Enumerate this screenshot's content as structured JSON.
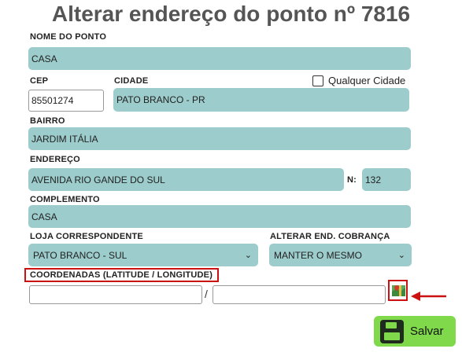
{
  "title": "Alterar endereço do ponto nº 7816",
  "fields": {
    "nome_label": "NOME DO PONTO",
    "nome_value": "CASA",
    "cep_label": "CEP",
    "cep_value": "85501274",
    "cidade_label": "CIDADE",
    "qualquer_cidade_label": "Qualquer Cidade",
    "cidade_value": "PATO BRANCO - PR",
    "bairro_label": "BAIRRO",
    "bairro_value": "JARDIM ITÁLIA",
    "endereco_label": "ENDEREÇO",
    "endereco_value": "AVENIDA RIO GANDE DO SUL",
    "numero_label": "N:",
    "numero_value": "132",
    "complemento_label": "COMPLEMENTO",
    "complemento_value": "CASA",
    "loja_label": "LOJA CORRESPONDENTE",
    "loja_value": "PATO BRANCO - SUL",
    "cobranca_label": "ALTERAR END. COBRANÇA",
    "cobranca_value": "MANTER O MESMO",
    "coord_label": "COORDENADAS (LATITUDE / LONGITUDE)",
    "coord_separator": "/",
    "latitude_value": "",
    "longitude_value": ""
  },
  "save_label": "Salvar",
  "icons": {
    "map": "map-icon",
    "arrow": "left-arrow-icon",
    "save": "floppy-disk-icon",
    "chevron": "chevron-down-icon"
  },
  "colors": {
    "field_bg": "#9ccccb",
    "highlight": "#cc1111",
    "save_bg": "#7fd94a"
  }
}
